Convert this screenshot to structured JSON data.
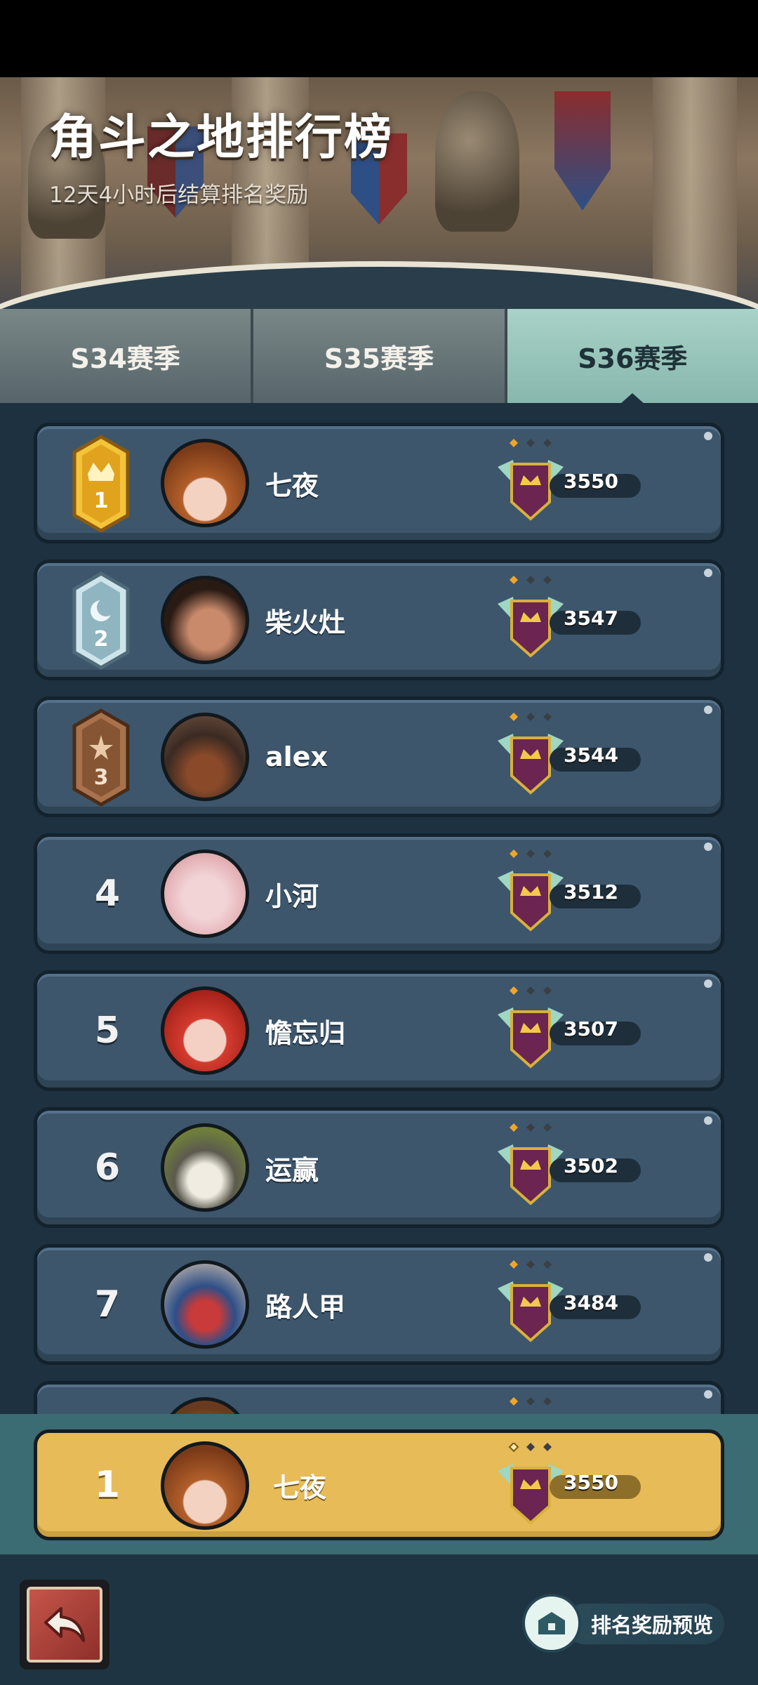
{
  "header": {
    "title": "角斗之地排行榜",
    "subtitle": "12天4小时后结算排名奖励"
  },
  "tabs": [
    {
      "label": "S34赛季",
      "active": false
    },
    {
      "label": "S35赛季",
      "active": false
    },
    {
      "label": "S36赛季",
      "active": true
    }
  ],
  "leaderboard": [
    {
      "rank": "1",
      "badge": "gold-crown-badge",
      "name": "七夜",
      "score": "3550"
    },
    {
      "rank": "2",
      "badge": "silver-moon-badge",
      "name": "柴火灶",
      "score": "3547"
    },
    {
      "rank": "3",
      "badge": "bronze-star-badge",
      "name": "alex",
      "score": "3544"
    },
    {
      "rank": "4",
      "badge": "",
      "name": "小河",
      "score": "3512"
    },
    {
      "rank": "5",
      "badge": "",
      "name": "憺忘归",
      "score": "3507"
    },
    {
      "rank": "6",
      "badge": "",
      "name": "运赢",
      "score": "3502"
    },
    {
      "rank": "7",
      "badge": "",
      "name": "路人甲",
      "score": "3484"
    }
  ],
  "self_entry": {
    "rank": "1",
    "name": "七夜",
    "score": "3550"
  },
  "footer": {
    "back_icon": "back-arrow-icon",
    "reward_preview_label": "排名奖励预览"
  },
  "colors": {
    "row_bg": "#3d566c",
    "self_row_bg": "#e6bb58",
    "active_tab": "#a9d2c8",
    "gold": "#f0b62c",
    "silver": "#b9d3da",
    "bronze": "#9a6a4a"
  }
}
